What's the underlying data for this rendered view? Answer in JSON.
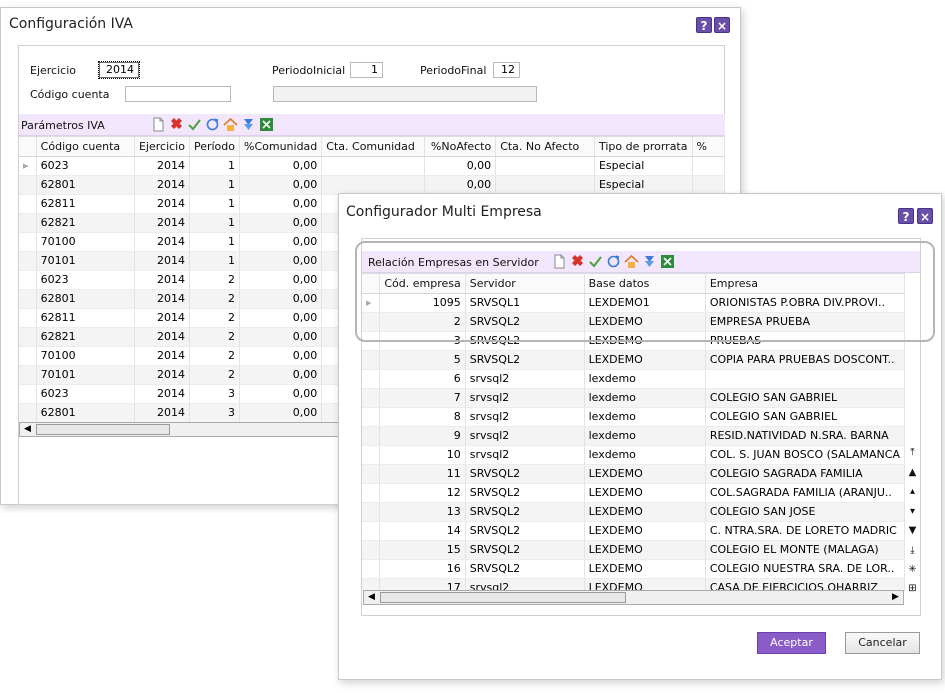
{
  "iva_window": {
    "title": "Configuración IVA",
    "help_label": "?",
    "close_label": "×",
    "ejercicio_label": "Ejercicio",
    "ejercicio_value": "2014",
    "periodo_inicial_label": "PeriodoInicial",
    "periodo_inicial_value": "1",
    "periodo_final_label": "PeriodoFinal",
    "periodo_final_value": "12",
    "codigo_cuenta_label": "Código cuenta",
    "codigo_cuenta_value": "",
    "codigo_cuenta_desc": "",
    "section_label": "Parámetros IVA",
    "columns": [
      "Código cuenta",
      "Ejercicio",
      "Período",
      "%Comunidad",
      "Cta. Comunidad",
      "%NoAfecto",
      "Cta. No Afecto",
      "Tipo de prorrata",
      "%"
    ],
    "rows": [
      [
        "6023",
        "2014",
        "1",
        "0,00",
        "",
        "0,00",
        "",
        "Especial"
      ],
      [
        "62801",
        "2014",
        "1",
        "0,00",
        "",
        "0,00",
        "",
        "Especial"
      ],
      [
        "62811",
        "2014",
        "1",
        "0,00",
        "",
        "",
        "",
        ""
      ],
      [
        "62821",
        "2014",
        "1",
        "0,00",
        "",
        "",
        "",
        ""
      ],
      [
        "70100",
        "2014",
        "1",
        "0,00",
        "",
        "",
        "",
        ""
      ],
      [
        "70101",
        "2014",
        "1",
        "0,00",
        "",
        "",
        "",
        ""
      ],
      [
        "6023",
        "2014",
        "2",
        "0,00",
        "",
        "",
        "",
        ""
      ],
      [
        "62801",
        "2014",
        "2",
        "0,00",
        "",
        "",
        "",
        ""
      ],
      [
        "62811",
        "2014",
        "2",
        "0,00",
        "",
        "",
        "",
        ""
      ],
      [
        "62821",
        "2014",
        "2",
        "0,00",
        "",
        "",
        "",
        ""
      ],
      [
        "70100",
        "2014",
        "2",
        "0,00",
        "",
        "",
        "",
        ""
      ],
      [
        "70101",
        "2014",
        "2",
        "0,00",
        "",
        "",
        "",
        ""
      ],
      [
        "6023",
        "2014",
        "3",
        "0,00",
        "",
        "",
        "",
        ""
      ],
      [
        "62801",
        "2014",
        "3",
        "0,00",
        "",
        "",
        "",
        ""
      ]
    ]
  },
  "multi_window": {
    "title": "Configurador Multi Empresa",
    "help_label": "?",
    "close_label": "×",
    "section_label": "Relación Empresas en Servidor",
    "columns": [
      "Cód. empresa",
      "Servidor",
      "Base datos",
      "Empresa"
    ],
    "rows": [
      [
        "1095",
        "SRVSQL1",
        "LEXDEMO1",
        "ORIONISTAS P.OBRA DIV.PROVI.."
      ],
      [
        "2",
        "SRVSQL2",
        "LEXDEMO",
        "EMPRESA PRUEBA"
      ],
      [
        "3",
        "SRVSQL2",
        "LEXDEMO",
        "PRUEBAS"
      ],
      [
        "5",
        "SRVSQL2",
        "LEXDEMO",
        "COPIA PARA PRUEBAS DOSCONT.."
      ],
      [
        "6",
        "srvsql2",
        "lexdemo",
        ""
      ],
      [
        "7",
        "srvsql2",
        "lexdemo",
        "COLEGIO SAN GABRIEL"
      ],
      [
        "8",
        "srvsql2",
        "lexdemo",
        "COLEGIO SAN GABRIEL"
      ],
      [
        "9",
        "srvsql2",
        "lexdemo",
        "RESID.NATIVIDAD N.SRA. BARNA"
      ],
      [
        "10",
        "srvsql2",
        "lexdemo",
        "COL. S. JUAN BOSCO (SALAMANCA"
      ],
      [
        "11",
        "SRVSQL2",
        "LEXDEMO",
        "COLEGIO SAGRADA FAMILIA"
      ],
      [
        "12",
        "SRVSQL2",
        "LEXDEMO",
        "COL.SAGRADA FAMILIA (ARANJU.."
      ],
      [
        "13",
        "SRVSQL2",
        "LEXDEMO",
        "COLEGIO SAN JOSE"
      ],
      [
        "14",
        "SRVSQL2",
        "LEXDEMO",
        "C. NTRA.SRA. DE LORETO MADRIC"
      ],
      [
        "15",
        "SRVSQL2",
        "LEXDEMO",
        "COLEGIO EL MONTE (MALAGA)"
      ],
      [
        "16",
        "SRVSQL2",
        "LEXDEMO",
        "COLEGIO NUESTRA SRA. DE LOR.."
      ],
      [
        "17",
        "srvsql2",
        "LEXDEMO",
        "CASA DE EJERCICIOS OHARRIZ"
      ]
    ],
    "accept_label": "Aceptar",
    "cancel_label": "Cancelar"
  },
  "icons": [
    "new-icon",
    "delete-icon",
    "confirm-icon",
    "refresh-icon",
    "home-icon",
    "download-icon",
    "excel-icon"
  ],
  "colors": {
    "accent": "#8a5cc7",
    "toolbar_bg": "#f1e6fb",
    "title_btn": "#6a4fa8"
  }
}
